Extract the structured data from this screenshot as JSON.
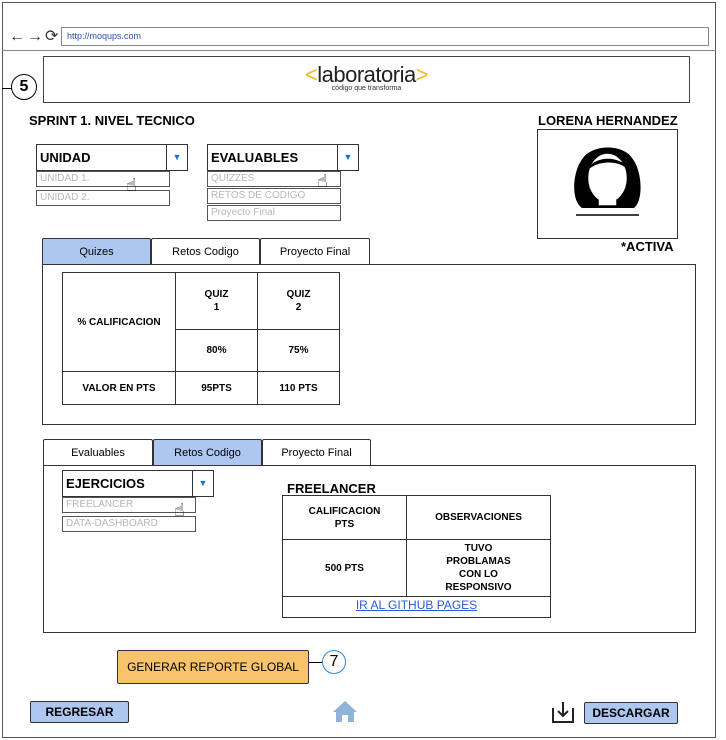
{
  "browser": {
    "url": "http://moqups.com",
    "back_icon": "←",
    "forward_icon": "→",
    "reload_icon": "⟳"
  },
  "badges": {
    "step5": "5",
    "step7": "7"
  },
  "logo": {
    "open": "<",
    "name": "laboratoria",
    "close": ">",
    "tagline": "código que transforma"
  },
  "header": {
    "sprint": "SPRINT 1.  NIVEL TECNICO",
    "student": "LORENA HERNANDEZ",
    "status": "*ACTIVA"
  },
  "unidad_select": {
    "label": "UNIDAD",
    "options": [
      "UNIDAD 1.",
      "UNIDAD 2."
    ]
  },
  "evaluables_select": {
    "label": "EVALUABLES",
    "options": [
      "QUIZZES",
      "RETOS DE CODIGO",
      "Proyecto Final"
    ]
  },
  "tabs_top": [
    "Quizes",
    "Retos Codigo",
    "Proyecto Final"
  ],
  "quiz_table": {
    "row_header": "% CALIFICACION",
    "quiz1": "QUIZ\n1",
    "quiz2": "QUIZ\n2",
    "q1_pct": "80%",
    "q2_pct": "75%",
    "pts_label": "VALOR EN PTS",
    "q1_pts": "95PTS",
    "q2_pts": "110 PTS"
  },
  "tabs_bottom": [
    "Evaluables",
    "Retos Codigo",
    "Proyecto Final"
  ],
  "ejercicios_select": {
    "label": "EJERCICIOS",
    "options": [
      "FREELANCER",
      "DATA-DASHBOARD"
    ]
  },
  "freelancer": {
    "title": "FREELANCER",
    "col1": "CALIFICACION\nPTS",
    "col2": "OBSERVACIONES",
    "score": "500 PTS",
    "observation": "TUVO\nPROBLAMAS\nCON LO\nRESPONSIVO",
    "link": "IR AL GITHUB PAGES"
  },
  "actions": {
    "report": "GENERAR REPORTE GLOBAL",
    "back": "REGRESAR",
    "download": "DESCARGAR"
  },
  "colors": {
    "tab_active": "#aec7f0",
    "report_button": "#f8c36b",
    "logo_accent": "#f5b820"
  }
}
